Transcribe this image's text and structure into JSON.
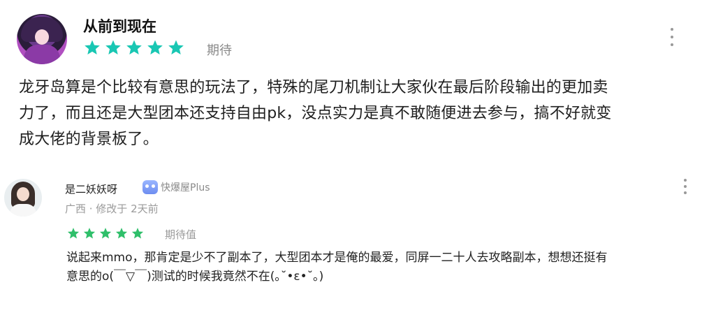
{
  "review": {
    "username": "从前到现在",
    "rating": 5,
    "rating_max": 5,
    "rating_label": "期待",
    "star_color": "#19c7b3",
    "content_lines": [
      "龙牙岛算是个比较有意思的玩法了，特殊的尾刀机制让大家伙在最后阶段输出的更加卖",
      "力了，而且还是大型团本还支持自由pk，没点实力是真不敢随便进去参与，搞不好就变",
      "成大佬的背景板了。"
    ]
  },
  "reply": {
    "username": "是二妖妖呀",
    "badge_icon": "kuaibaowu-plus-icon",
    "badge_label": "快爆屋Plus",
    "meta": "广西 · 修改于 2天前",
    "rating": 5,
    "rating_max": 5,
    "rating_label": "期待值",
    "star_color": "#2fbf6a",
    "content_lines": [
      "说起来mmo，那肯定是少不了副本了，大型团本才是俺的最爱，同屏一二十人去攻略副本，想想还挺有",
      "意思的o(￣▽￣)测试的时候我竟然不在(｡˘•ε•˘｡)"
    ]
  }
}
